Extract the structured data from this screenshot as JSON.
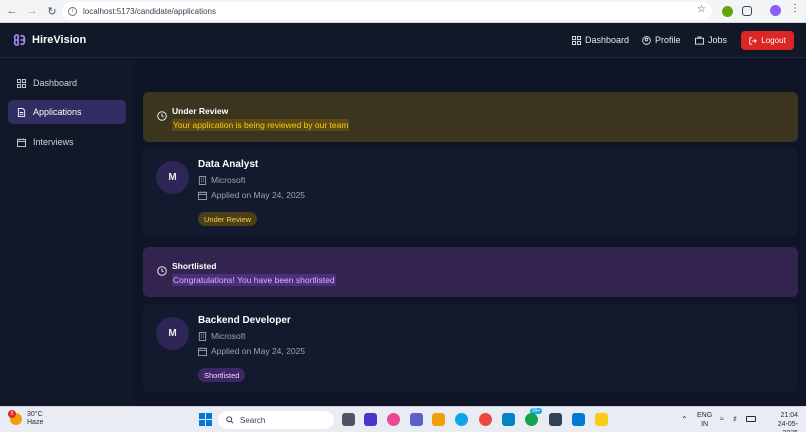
{
  "browser": {
    "url": "localhost:5173/candidate/applications"
  },
  "header": {
    "brand": "HireVision",
    "nav": [
      {
        "label": "Dashboard",
        "icon": "grid-icon"
      },
      {
        "label": "Profile",
        "icon": "user-circle-icon"
      },
      {
        "label": "Jobs",
        "icon": "briefcase-icon"
      }
    ],
    "logout_label": "Logout"
  },
  "sidebar": {
    "items": [
      {
        "label": "Dashboard",
        "icon": "grid-icon",
        "active": false
      },
      {
        "label": "Applications",
        "icon": "document-icon",
        "active": true
      },
      {
        "label": "Interviews",
        "icon": "calendar-icon",
        "active": false
      }
    ]
  },
  "applications": [
    {
      "status_title": "Under Review",
      "status_message": "Your application is being reviewed by our team",
      "avatar_letter": "M",
      "job_title": "Data Analyst",
      "company": "Microsoft",
      "applied": "Applied on May 24, 2025",
      "badge": "Under Review",
      "colors": {
        "banner_bg": "#3b3520",
        "msg_bg": "#5b4a13",
        "msg_fg": "#facc15",
        "badge_bg": "#4a3f17",
        "badge_fg": "#fcd34d"
      }
    },
    {
      "status_title": "Shortlisted",
      "status_message": "Congratulations! You have been shortlisted",
      "avatar_letter": "M",
      "job_title": "Backend Developer",
      "company": "Microsoft",
      "applied": "Applied on May 24, 2025",
      "badge": "Shortlisted",
      "colors": {
        "banner_bg": "#33234f",
        "msg_bg": "#4c2f7a",
        "msg_fg": "#d8b4fe",
        "badge_bg": "#3f2766",
        "badge_fg": "#e9d5ff"
      }
    }
  ],
  "taskbar": {
    "temperature": "30°C",
    "weather": "Haze",
    "weather_badge": "5",
    "search_placeholder": "Search",
    "lang_top": "ENG",
    "lang_bottom": "IN",
    "time": "21:04",
    "date": "24-05-2025",
    "notification_badge": "99+"
  }
}
